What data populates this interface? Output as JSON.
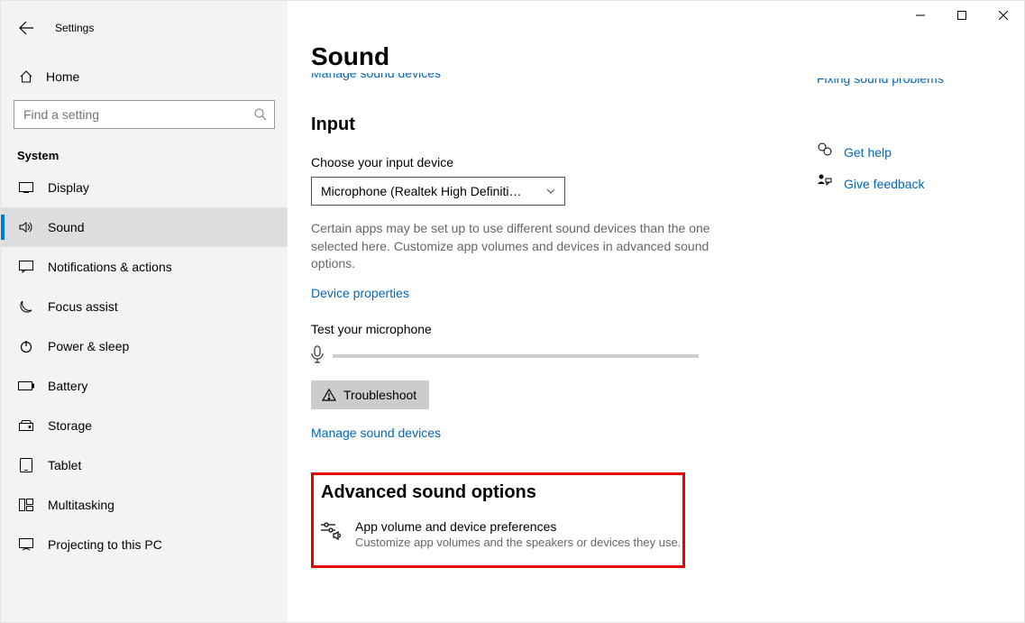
{
  "app_title": "Settings",
  "home_label": "Home",
  "search_placeholder": "Find a setting",
  "section_label": "System",
  "nav_items": [
    {
      "label": "Display"
    },
    {
      "label": "Sound"
    },
    {
      "label": "Notifications & actions"
    },
    {
      "label": "Focus assist"
    },
    {
      "label": "Power & sleep"
    },
    {
      "label": "Battery"
    },
    {
      "label": "Storage"
    },
    {
      "label": "Tablet"
    },
    {
      "label": "Multitasking"
    },
    {
      "label": "Projecting to this PC"
    }
  ],
  "active_nav_index": 1,
  "page": {
    "title": "Sound",
    "top_clipped_link": "Manage sound devices",
    "input_h": "Input",
    "choose_label": "Choose your input device",
    "selected_device": "Microphone (Realtek High Definitio…",
    "desc": "Certain apps may be set up to use different sound devices than the one selected here. Customize app volumes and devices in advanced sound options.",
    "device_props": "Device properties",
    "test_label": "Test your microphone",
    "troubleshoot": "Troubleshoot",
    "manage_link": "Manage sound devices",
    "adv_h": "Advanced sound options",
    "adv_item_title": "App volume and device preferences",
    "adv_item_desc": "Customize app volumes and the speakers or devices they use."
  },
  "right": {
    "clipped_link": "Fixing sound problems",
    "help": "Get help",
    "feedback": "Give feedback"
  }
}
